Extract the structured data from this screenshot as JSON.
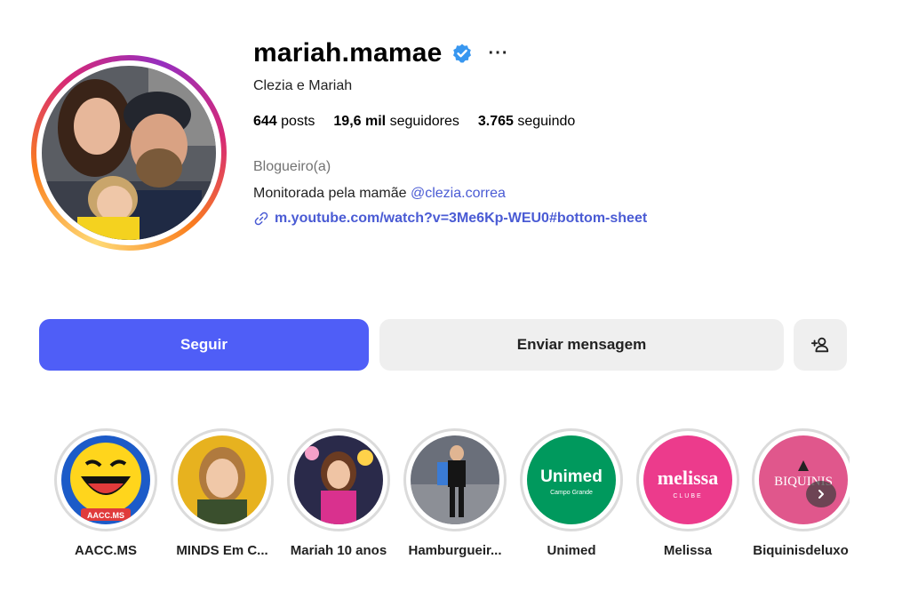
{
  "profile": {
    "username": "mariah.mamae",
    "full_name": "Clezia e Mariah",
    "more_label": "···",
    "verified_icon": "verified-badge-icon",
    "accent_color": "#4f5ef7",
    "link_color": "#4a5bd4"
  },
  "stats": {
    "posts_value": "644",
    "posts_label": "posts",
    "followers_value": "19,6 mil",
    "followers_label": "seguidores",
    "following_value": "3.765",
    "following_label": "seguindo"
  },
  "bio": {
    "category": "Blogueiro(a)",
    "text": "Monitorada pela mamãe ",
    "mention": "@clezia.correa",
    "link": "m.youtube.com/watch?v=3Me6Kp-WEU0#bottom-sheet"
  },
  "actions": {
    "follow_label": "Seguir",
    "message_label": "Enviar mensagem",
    "add_user_icon": "add-user-icon"
  },
  "highlights": [
    {
      "label": "AACC.MS",
      "image_text": "AACC.MS"
    },
    {
      "label": "MINDS Em C..."
    },
    {
      "label": "Mariah 10 anos"
    },
    {
      "label": "Hamburgueir..."
    },
    {
      "label": "Unimed",
      "image_text": "Unimed",
      "image_subtext": "Campo Grande"
    },
    {
      "label": "Melissa",
      "image_text": "melissa",
      "image_subtext": "CLUBE"
    },
    {
      "label": "Biquinisdeluxo",
      "image_text": "BIQUINIS"
    }
  ],
  "next_icon": "chevron-right-icon"
}
